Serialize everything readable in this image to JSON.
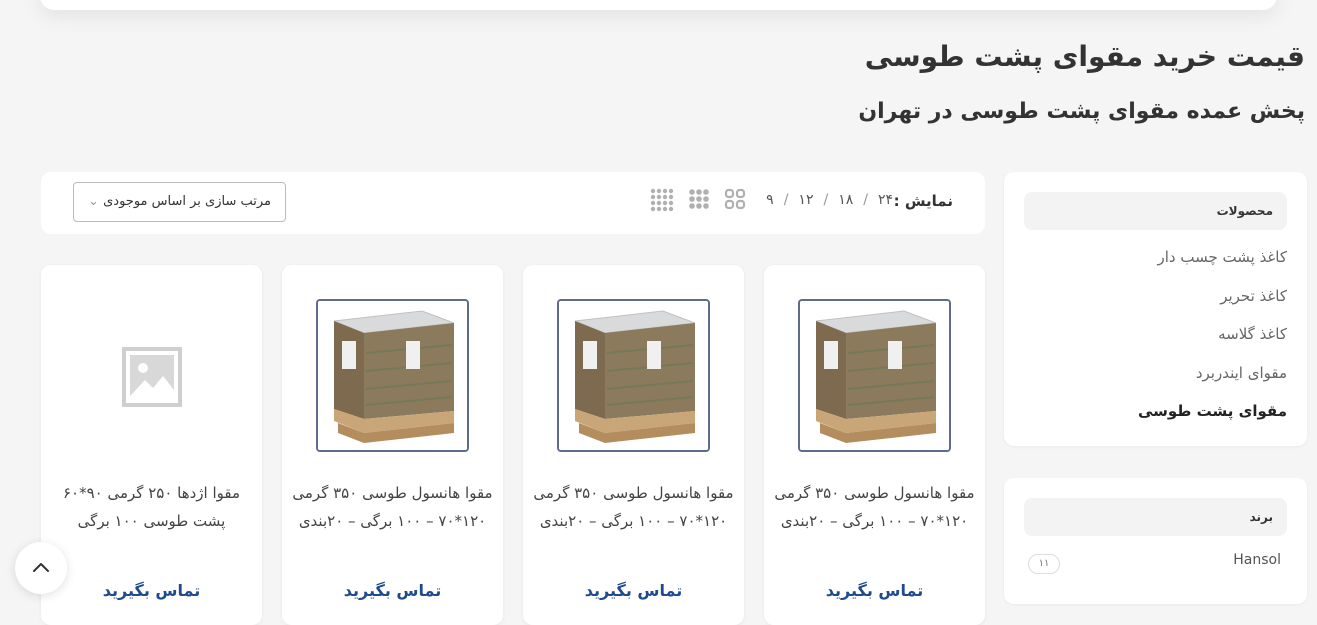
{
  "header": {
    "title": "قیمت خرید مقوای پشت طوسی",
    "subtitle": "پخش عمده مقوای پشت طوسی در تهران"
  },
  "sidebar": {
    "categories_title": "محصولات",
    "categories": [
      {
        "label": "کاغذ پشت چسب دار",
        "active": false
      },
      {
        "label": "کاغذ تحریر",
        "active": false
      },
      {
        "label": "کاغذ گلاسه",
        "active": false
      },
      {
        "label": "مقوای ایندربرد",
        "active": false
      },
      {
        "label": "مقوای پشت طوسی",
        "active": true
      }
    ],
    "brand_title": "برند",
    "brands": [
      {
        "name": "Hansol",
        "count": "۱۱"
      }
    ]
  },
  "toolbar": {
    "show_label": "نمایش :",
    "show_options": [
      "۹",
      "۱۲",
      "۱۸",
      "۲۴"
    ],
    "sort_label": "مرتب سازی بر اساس موجودی",
    "view_icons": [
      "grid-2-icon",
      "grid-3-icon",
      "grid-4-icon"
    ]
  },
  "products": [
    {
      "name": "مقوا هانسول طوسی ۳۵۰ گرمی ۱۲۰*۷۰ – ۱۰۰ برگی – ۲۰بندی",
      "cta": "تماس بگیرید",
      "image": "pallet"
    },
    {
      "name": "مقوا هانسول طوسی ۳۵۰ گرمی ۱۲۰*۷۰ – ۱۰۰ برگی – ۲۰بندی",
      "cta": "تماس بگیرید",
      "image": "pallet"
    },
    {
      "name": "مقوا هانسول طوسی ۳۵۰ گرمی ۱۲۰*۷۰ – ۱۰۰ برگی – ۲۰بندی",
      "cta": "تماس بگیرید",
      "image": "pallet"
    },
    {
      "name": "مقوا اژدها ۲۵۰ گرمی ۹۰*۶۰ پشت طوسی ۱۰۰ برگی",
      "cta": "تماس بگیرید",
      "image": "placeholder"
    }
  ],
  "colors": {
    "accent": "#1f4b8e",
    "frame": "#5d6b8f",
    "background": "#f5f5f5"
  }
}
